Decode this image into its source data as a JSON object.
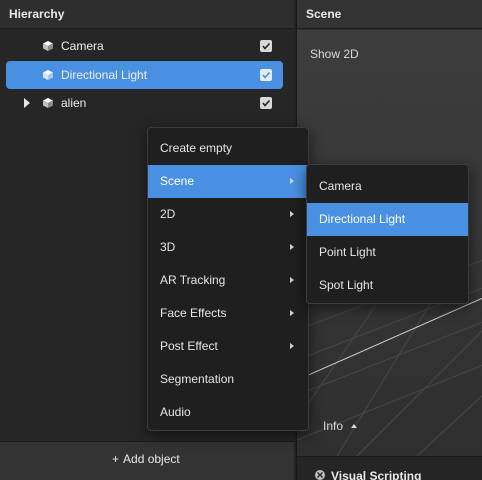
{
  "hierarchy": {
    "title": "Hierarchy",
    "items": [
      {
        "label": "Camera",
        "checked": true,
        "selected": false,
        "expandable": false
      },
      {
        "label": "Directional Light",
        "checked": true,
        "selected": true,
        "expandable": false
      },
      {
        "label": "alien",
        "checked": true,
        "selected": false,
        "expandable": true
      }
    ],
    "add_object_label": "Add object"
  },
  "scene": {
    "title": "Scene",
    "show2d_label": "Show 2D",
    "info_label": "Info",
    "visual_scripting_label": "Visual Scripting"
  },
  "context_menu": {
    "items": [
      {
        "label": "Create empty",
        "submenu": false,
        "highlighted": false
      },
      {
        "label": "Scene",
        "submenu": true,
        "highlighted": true
      },
      {
        "label": "2D",
        "submenu": true,
        "highlighted": false
      },
      {
        "label": "3D",
        "submenu": true,
        "highlighted": false
      },
      {
        "label": "AR Tracking",
        "submenu": true,
        "highlighted": false
      },
      {
        "label": "Face Effects",
        "submenu": true,
        "highlighted": false
      },
      {
        "label": "Post Effect",
        "submenu": true,
        "highlighted": false
      },
      {
        "label": "Segmentation",
        "submenu": false,
        "highlighted": false
      },
      {
        "label": "Audio",
        "submenu": false,
        "highlighted": false
      }
    ]
  },
  "scene_submenu": {
    "items": [
      {
        "label": "Camera",
        "highlighted": false
      },
      {
        "label": "Directional Light",
        "highlighted": true
      },
      {
        "label": "Point Light",
        "highlighted": false
      },
      {
        "label": "Spot Light",
        "highlighted": false
      }
    ]
  },
  "colors": {
    "accent": "#4a90e2",
    "panel": "#262626",
    "menu": "#1f1f1f"
  },
  "icons": {
    "object": "cube-icon",
    "visible": "checkbox-icon",
    "expand": "triangle-right-icon",
    "add": "plus-icon",
    "submenu": "chevron-right-icon",
    "close": "close-icon"
  }
}
